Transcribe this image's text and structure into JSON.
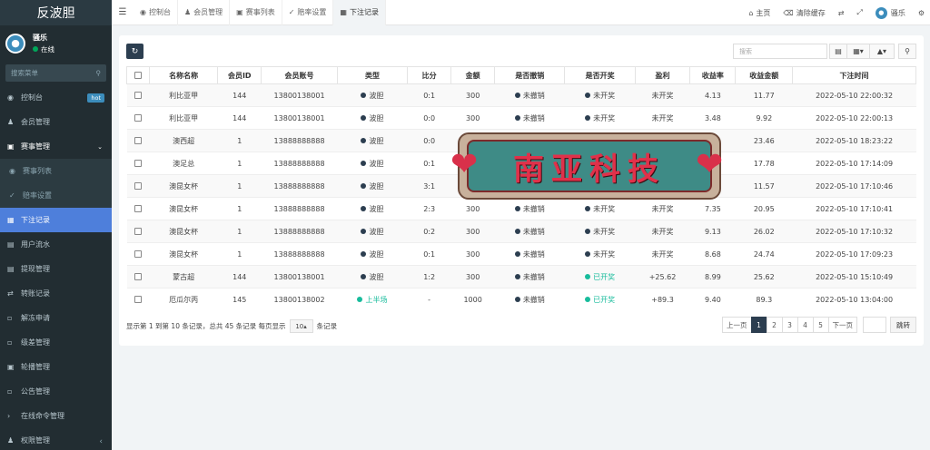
{
  "app": {
    "title": "反波胆",
    "user_name": "骚乐",
    "user_status": "在线",
    "search_placeholder": "搜索菜单"
  },
  "sidebar": {
    "items": [
      {
        "label": "控制台",
        "icon": "dashboard-icon",
        "badge": "hot"
      },
      {
        "label": "会员管理",
        "icon": "users-icon"
      },
      {
        "label": "赛事管理",
        "icon": "gamepad-icon"
      },
      {
        "label": "赛事列表",
        "icon": "list-icon"
      },
      {
        "label": "赔率设置",
        "icon": "vk-icon"
      },
      {
        "label": "下注记录",
        "icon": "calendar-icon"
      },
      {
        "label": "用户流水",
        "icon": "file-icon"
      },
      {
        "label": "提现管理",
        "icon": "file-icon"
      },
      {
        "label": "转账记录",
        "icon": "transfer-icon"
      },
      {
        "label": "解冻申请",
        "icon": "doc-icon"
      },
      {
        "label": "级差管理",
        "icon": "doc-icon"
      },
      {
        "label": "轮播管理",
        "icon": "image-icon"
      },
      {
        "label": "公告管理",
        "icon": "doc-icon"
      },
      {
        "label": "在线命令管理",
        "icon": "terminal-icon"
      },
      {
        "label": "权限管理",
        "icon": "group-icon"
      }
    ]
  },
  "topbar": {
    "tabs": [
      {
        "label": "控制台",
        "icon": "dashboard-icon"
      },
      {
        "label": "会员管理",
        "icon": "users-icon"
      },
      {
        "label": "赛事列表",
        "icon": "gamepad-icon"
      },
      {
        "label": "赔率设置",
        "icon": "vk-icon"
      },
      {
        "label": "下注记录",
        "icon": "calendar-icon"
      }
    ],
    "home": "主页",
    "clear_cache": "清除缓存",
    "user": "骚乐"
  },
  "toolbar": {
    "search_placeholder": "搜索"
  },
  "table": {
    "headers": [
      "名称名称",
      "会员ID",
      "会员账号",
      "类型",
      "比分",
      "金额",
      "是否撤销",
      "是否开奖",
      "盈利",
      "收益率",
      "收益金额",
      "下注时间"
    ],
    "rows": [
      [
        "利比亚甲",
        "144",
        "13800138001",
        "波胆",
        "0:1",
        "300",
        "未撤销",
        "未开奖",
        "未开奖",
        "4.13",
        "11.77",
        "2022-05-10 22:00:32"
      ],
      [
        "利比亚甲",
        "144",
        "13800138001",
        "波胆",
        "0:0",
        "300",
        "未撤销",
        "未开奖",
        "未开奖",
        "3.48",
        "9.92",
        "2022-05-10 22:00:13"
      ],
      [
        "澳西超",
        "1",
        "13888888888",
        "波胆",
        "0:0",
        "",
        "",
        "",
        "",
        "",
        "23.46",
        "2022-05-10 18:23:22"
      ],
      [
        "澳足总",
        "1",
        "13888888888",
        "波胆",
        "0:1",
        "",
        "",
        "",
        "",
        "",
        "17.78",
        "2022-05-10 17:14:09"
      ],
      [
        "澳昆女杯",
        "1",
        "13888888888",
        "波胆",
        "3:1",
        "",
        "",
        "",
        "",
        "",
        "11.57",
        "2022-05-10 17:10:46"
      ],
      [
        "澳昆女杯",
        "1",
        "13888888888",
        "波胆",
        "2:3",
        "300",
        "未撤销",
        "未开奖",
        "未开奖",
        "7.35",
        "20.95",
        "2022-05-10 17:10:41"
      ],
      [
        "澳昆女杯",
        "1",
        "13888888888",
        "波胆",
        "0:2",
        "300",
        "未撤销",
        "未开奖",
        "未开奖",
        "9.13",
        "26.02",
        "2022-05-10 17:10:32"
      ],
      [
        "澳昆女杯",
        "1",
        "13888888888",
        "波胆",
        "0:1",
        "300",
        "未撤销",
        "未开奖",
        "未开奖",
        "8.68",
        "24.74",
        "2022-05-10 17:09:23"
      ],
      [
        "蒙古超",
        "144",
        "13800138001",
        "波胆",
        "1:2",
        "300",
        "未撤销",
        "已开奖",
        "+25.62",
        "8.99",
        "25.62",
        "2022-05-10 15:10:49"
      ],
      [
        "厄瓜尔丙",
        "145",
        "13800138002",
        "上半场",
        "-",
        "1000",
        "未撤销",
        "已开奖",
        "+89.3",
        "9.40",
        "89.3",
        "2022-05-10 13:04:00"
      ]
    ]
  },
  "pagination": {
    "summary_prefix": "显示第 1 到第 10 条记录，总共 45 条记录 每页显示",
    "page_size": "10",
    "summary_suffix": "条记录",
    "prev": "上一页",
    "pages": [
      "1",
      "2",
      "3",
      "4",
      "5"
    ],
    "next": "下一页",
    "jump": "跳转"
  },
  "watermark": {
    "text": "南亚科技"
  }
}
